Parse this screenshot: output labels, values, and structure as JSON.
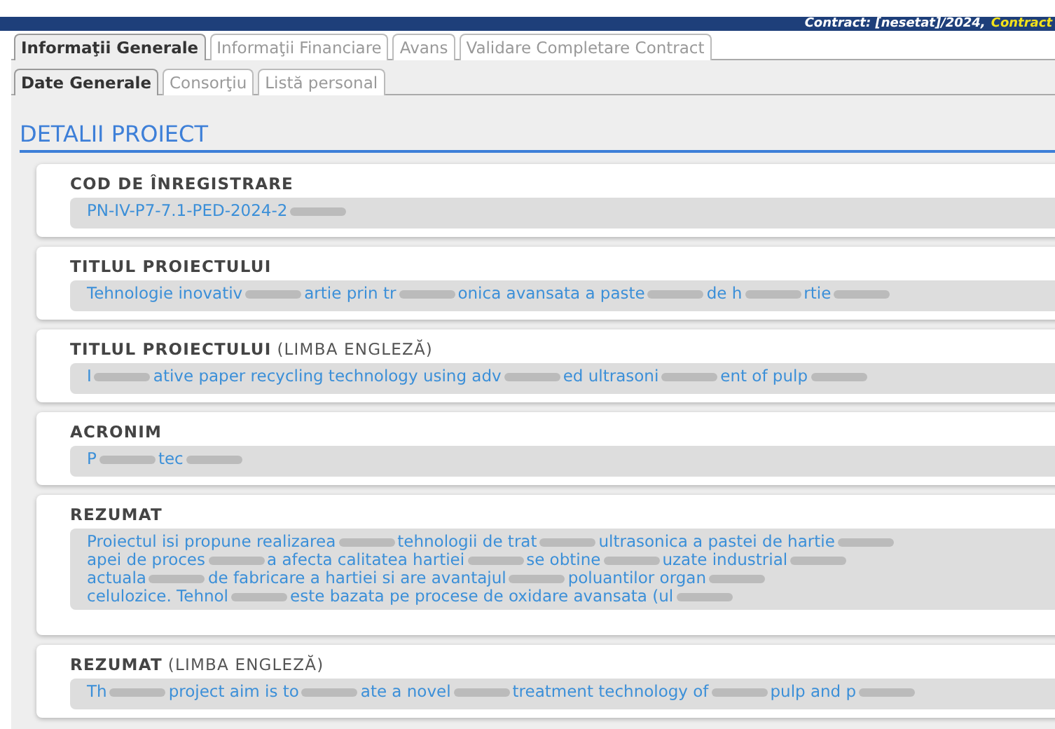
{
  "header": {
    "contract": "Contract: [nesetat]/2024,",
    "contract_status": "Contract"
  },
  "tabs": [
    {
      "label": "Informaţii Generale",
      "selected": true
    },
    {
      "label": "Informaţii Financiare",
      "selected": false
    },
    {
      "label": "Avans",
      "selected": false
    },
    {
      "label": "Validare Completare Contract",
      "selected": false
    }
  ],
  "subtabs": [
    {
      "label": "Date Generale",
      "selected": true
    },
    {
      "label": "Consorţiu",
      "selected": false
    },
    {
      "label": "Listă personal",
      "selected": false
    }
  ],
  "section_title": "DETALII PROIECT",
  "fields": [
    {
      "label": "COD DE ÎNREGISTRARE",
      "lines": [
        [
          "PN-IV-P7-7.1-PED-2024-2"
        ]
      ]
    },
    {
      "label": "TITLUL PROIECTULUI",
      "lines": [
        [
          "Tehnologie inovativ",
          "artie prin tr",
          "onica avansata a paste",
          "de h",
          "rtie"
        ]
      ]
    },
    {
      "label": "TITLUL PROIECTULUI",
      "note": "(LIMBA ENGLEZĂ)",
      "lines": [
        [
          "I",
          "ative paper recycling technology using adv",
          "ed ultrasoni",
          "ent of pulp"
        ]
      ]
    },
    {
      "label": "ACRONIM",
      "lines": [
        [
          "P",
          "tec"
        ]
      ]
    },
    {
      "label": "REZUMAT",
      "lines": [
        [
          "Proiectul isi propune realizarea",
          "tehnologii de trat",
          "ultrasonica a pastei de hartie"
        ],
        [
          "apei de proces",
          "a afecta calitatea hartiei",
          "se obtine",
          "uzate industrial"
        ],
        [
          "actuala",
          "de fabricare a hartiei si are avantajul",
          "poluantilor organ"
        ],
        [
          "celulozice. Tehnol",
          "este bazata pe procese de oxidare avansata (ul"
        ]
      ]
    },
    {
      "label": "REZUMAT",
      "note": "(LIMBA ENGLEZĂ)",
      "lines": [
        [
          "Th",
          "project aim is to",
          "ate a novel",
          "treatment technology of",
          "pulp and p"
        ]
      ]
    }
  ]
}
